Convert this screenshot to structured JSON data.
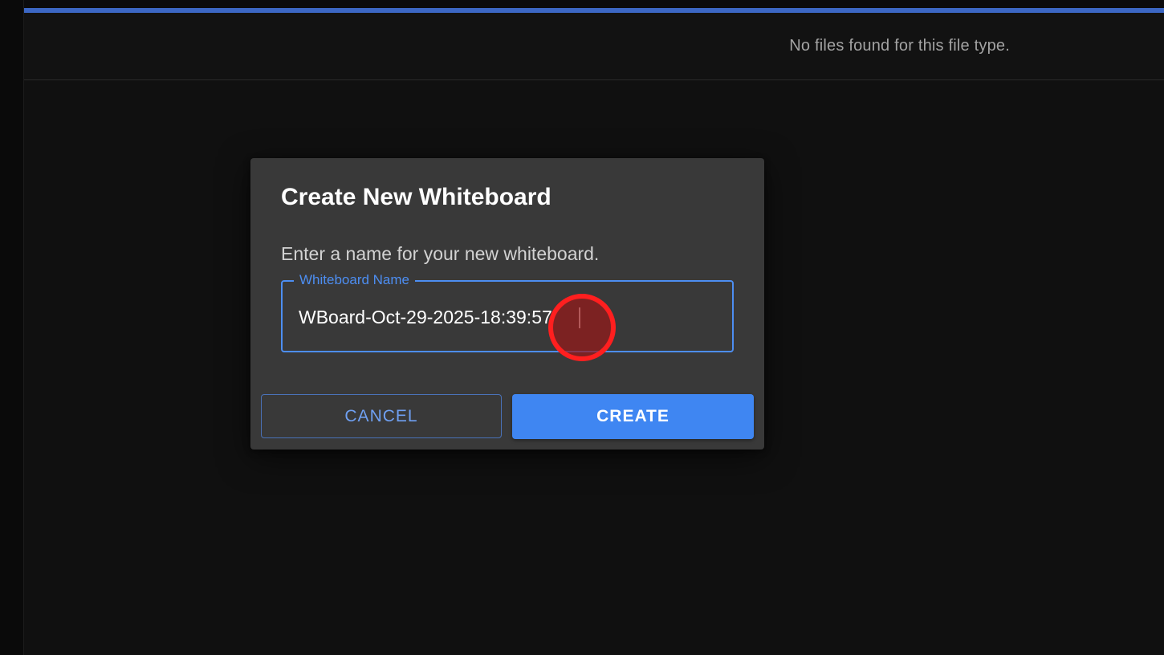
{
  "file_list": {
    "empty_message": "No files found for this file type."
  },
  "dialog": {
    "title": "Create New Whiteboard",
    "description": "Enter a name for your new whiteboard.",
    "field": {
      "label": "Whiteboard Name",
      "value": "WBoard-Oct-29-2025-18:39:57"
    },
    "buttons": {
      "cancel": "CANCEL",
      "create": "CREATE"
    }
  },
  "colors": {
    "accent": "#4d8ef2",
    "primary_button": "#3f86f2",
    "dialog_background": "#393939",
    "page_background": "#101010",
    "click_marker": "#ff1f1f"
  },
  "icons": {
    "click_marker": "click-indicator-icon"
  }
}
